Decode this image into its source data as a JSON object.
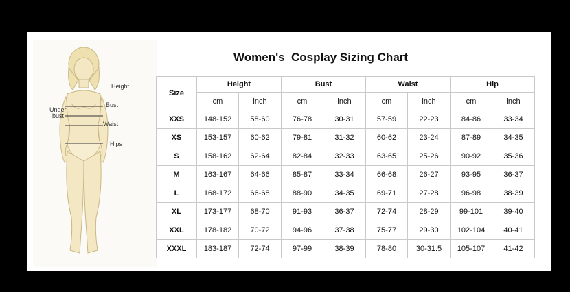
{
  "title": "Women's  Cosplay Sizing Chart",
  "figure_labels": {
    "height": "Height",
    "bust": "Bust",
    "under_bust_line1": "Under",
    "under_bust_line2": "bust",
    "waist": "Waist",
    "hips": "Hips"
  },
  "table": {
    "size_header": "Size",
    "groups": [
      "Height",
      "Bust",
      "Waist",
      "Hip"
    ],
    "units": [
      "cm",
      "inch",
      "cm",
      "inch",
      "cm",
      "inch",
      "cm",
      "inch"
    ],
    "rows": [
      {
        "size": "XXS",
        "values": [
          "148-152",
          "58-60",
          "76-78",
          "30-31",
          "57-59",
          "22-23",
          "84-86",
          "33-34"
        ]
      },
      {
        "size": "XS",
        "values": [
          "153-157",
          "60-62",
          "79-81",
          "31-32",
          "60-62",
          "23-24",
          "87-89",
          "34-35"
        ]
      },
      {
        "size": "S",
        "values": [
          "158-162",
          "62-64",
          "82-84",
          "32-33",
          "63-65",
          "25-26",
          "90-92",
          "35-36"
        ]
      },
      {
        "size": "M",
        "values": [
          "163-167",
          "64-66",
          "85-87",
          "33-34",
          "66-68",
          "26-27",
          "93-95",
          "36-37"
        ]
      },
      {
        "size": "L",
        "values": [
          "168-172",
          "66-68",
          "88-90",
          "34-35",
          "69-71",
          "27-28",
          "96-98",
          "38-39"
        ]
      },
      {
        "size": "XL",
        "values": [
          "173-177",
          "68-70",
          "91-93",
          "36-37",
          "72-74",
          "28-29",
          "99-101",
          "39-40"
        ]
      },
      {
        "size": "XXL",
        "values": [
          "178-182",
          "70-72",
          "94-96",
          "37-38",
          "75-77",
          "29-30",
          "102-104",
          "40-41"
        ]
      },
      {
        "size": "XXXL",
        "values": [
          "183-187",
          "72-74",
          "97-99",
          "38-39",
          "78-80",
          "30-31.5",
          "105-107",
          "41-42"
        ]
      }
    ]
  }
}
